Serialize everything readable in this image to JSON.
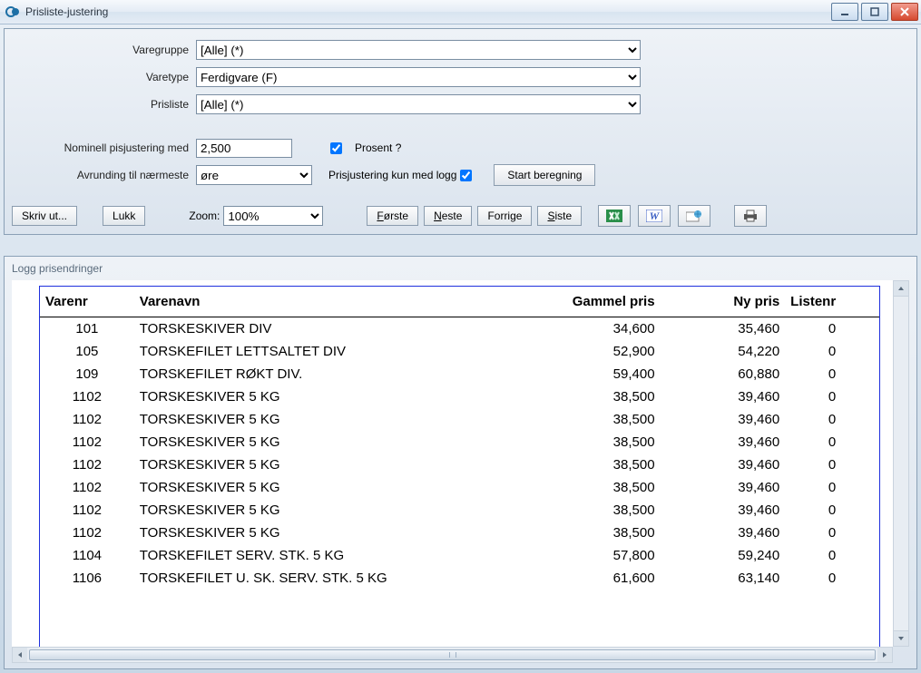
{
  "window": {
    "title": "Prisliste-justering"
  },
  "form": {
    "varegruppe_label": "Varegruppe",
    "varegruppe_value": "[Alle] (*)",
    "varetype_label": "Varetype",
    "varetype_value": "Ferdigvare (F)",
    "prisliste_label": "Prisliste",
    "prisliste_value": "[Alle] (*)",
    "nominell_label": "Nominell pisjustering med",
    "nominell_value": "2,500",
    "prosent_label": "Prosent ?",
    "prosent_checked": true,
    "avrunding_label": "Avrunding til nærmeste",
    "avrunding_value": "øre",
    "prisjustering_label": "Prisjustering kun med logg",
    "prisjustering_checked": true,
    "start_label": "Start beregning"
  },
  "toolbar": {
    "skriv_ut": "Skriv ut...",
    "lukk": "Lukk",
    "zoom_label": "Zoom:",
    "zoom_value": "100%",
    "forste": "Første",
    "neste": "Neste",
    "forrige": "Forrige",
    "siste": "Siste"
  },
  "report": {
    "title": "Logg prisendringer",
    "headers": {
      "varenr": "Varenr",
      "varenavn": "Varenavn",
      "gammel": "Gammel pris",
      "ny": "Ny pris",
      "liste": "Listenr"
    },
    "rows": [
      {
        "nr": "101",
        "navn": "TORSKESKIVER DIV",
        "g": "34,600",
        "n": "35,460",
        "l": "0"
      },
      {
        "nr": "105",
        "navn": "TORSKEFILET LETTSALTET DIV",
        "g": "52,900",
        "n": "54,220",
        "l": "0"
      },
      {
        "nr": "109",
        "navn": " TORSKEFILET RØKT DIV.",
        "g": "59,400",
        "n": "60,880",
        "l": "0"
      },
      {
        "nr": "1102",
        "navn": "TORSKESKIVER 5 KG",
        "g": "38,500",
        "n": "39,460",
        "l": "0"
      },
      {
        "nr": "1102",
        "navn": "TORSKESKIVER 5 KG",
        "g": "38,500",
        "n": "39,460",
        "l": "0"
      },
      {
        "nr": "1102",
        "navn": "TORSKESKIVER 5 KG",
        "g": "38,500",
        "n": "39,460",
        "l": "0"
      },
      {
        "nr": "1102",
        "navn": "TORSKESKIVER 5 KG",
        "g": "38,500",
        "n": "39,460",
        "l": "0"
      },
      {
        "nr": "1102",
        "navn": "TORSKESKIVER 5 KG",
        "g": "38,500",
        "n": "39,460",
        "l": "0"
      },
      {
        "nr": "1102",
        "navn": "TORSKESKIVER 5 KG",
        "g": "38,500",
        "n": "39,460",
        "l": "0"
      },
      {
        "nr": "1102",
        "navn": "TORSKESKIVER 5 KG",
        "g": "38,500",
        "n": "39,460",
        "l": "0"
      },
      {
        "nr": "1104",
        "navn": "TORSKEFILET SERV. STK. 5 KG",
        "g": "57,800",
        "n": "59,240",
        "l": "0"
      },
      {
        "nr": "1106",
        "navn": "TORSKEFILET U. SK. SERV. STK. 5 KG",
        "g": "61,600",
        "n": "63,140",
        "l": "0"
      }
    ]
  }
}
